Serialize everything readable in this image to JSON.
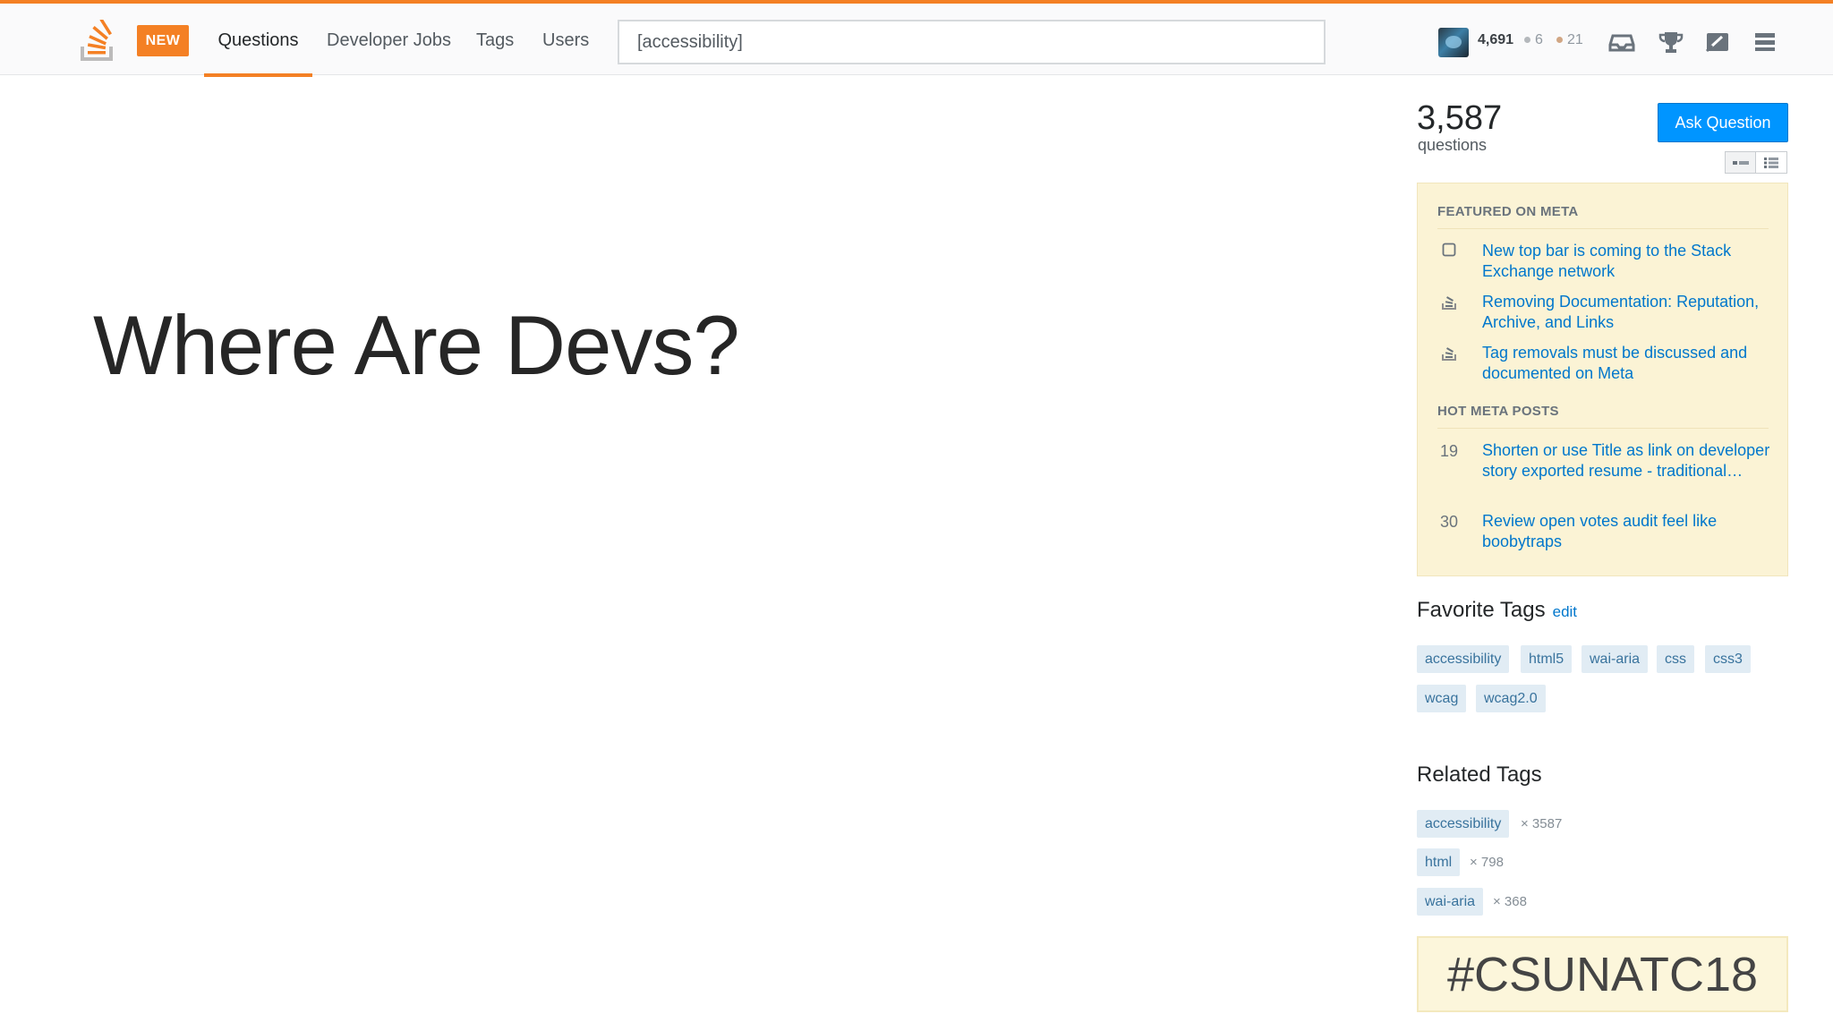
{
  "topbar": {
    "accent_color": "#f48024",
    "logo_icon": "stackoverflow-logo-icon",
    "new_badge": "NEW",
    "nav": [
      "Questions",
      "Developer Jobs",
      "Tags",
      "Users"
    ],
    "active_nav": "Questions",
    "search_value": "[accessibility]",
    "user": {
      "reputation": "4,691",
      "silver_badges": "6",
      "bronze_badges": "21"
    },
    "icons": [
      "inbox-icon",
      "trophy-icon",
      "review-icon",
      "menu-icon"
    ]
  },
  "slide": {
    "title": "Where Are Devs?",
    "hashtag": "#CSUNATC18"
  },
  "sidebar": {
    "question_count": "3,587",
    "question_label": "questions",
    "ask_button": "Ask Question",
    "ask_color": "#0095ff",
    "featured_header": "FEATURED ON META",
    "featured": [
      {
        "icon": "square-icon",
        "text": "New top bar is coming to the Stack Exchange network"
      },
      {
        "icon": "stack-icon",
        "text": "Removing Documentation: Reputation, Archive, and Links"
      },
      {
        "icon": "stack-icon",
        "text": "Tag removals must be discussed and documented on Meta"
      }
    ],
    "hot_header": "HOT META POSTS",
    "hot": [
      {
        "score": "19",
        "text": "Shorten or use Title as link on developer story exported resume - traditional…"
      },
      {
        "score": "30",
        "text": "Review open votes audit feel like boobytraps"
      }
    ],
    "favorite_title": "Favorite Tags",
    "favorite_edit": "edit",
    "favorite_tags": [
      "accessibility",
      "html5",
      "wai-aria",
      "css",
      "css3",
      "wcag",
      "wcag2.0"
    ],
    "related_title": "Related Tags",
    "related_tags": [
      {
        "name": "accessibility",
        "count": "× 3587"
      },
      {
        "name": "html",
        "count": "× 798"
      },
      {
        "name": "wai-aria",
        "count": "× 368"
      }
    ]
  }
}
